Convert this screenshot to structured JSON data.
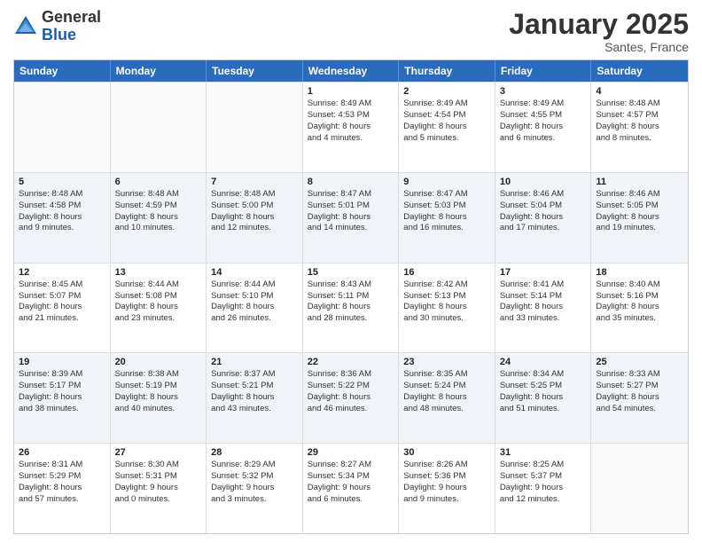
{
  "header": {
    "logo_general": "General",
    "logo_blue": "Blue",
    "month_title": "January 2025",
    "location": "Santes, France"
  },
  "weekdays": [
    "Sunday",
    "Monday",
    "Tuesday",
    "Wednesday",
    "Thursday",
    "Friday",
    "Saturday"
  ],
  "rows": [
    {
      "alt": false,
      "cells": [
        {
          "day": "",
          "lines": []
        },
        {
          "day": "",
          "lines": []
        },
        {
          "day": "",
          "lines": []
        },
        {
          "day": "1",
          "lines": [
            "Sunrise: 8:49 AM",
            "Sunset: 4:53 PM",
            "Daylight: 8 hours",
            "and 4 minutes."
          ]
        },
        {
          "day": "2",
          "lines": [
            "Sunrise: 8:49 AM",
            "Sunset: 4:54 PM",
            "Daylight: 8 hours",
            "and 5 minutes."
          ]
        },
        {
          "day": "3",
          "lines": [
            "Sunrise: 8:49 AM",
            "Sunset: 4:55 PM",
            "Daylight: 8 hours",
            "and 6 minutes."
          ]
        },
        {
          "day": "4",
          "lines": [
            "Sunrise: 8:48 AM",
            "Sunset: 4:57 PM",
            "Daylight: 8 hours",
            "and 8 minutes."
          ]
        }
      ]
    },
    {
      "alt": true,
      "cells": [
        {
          "day": "5",
          "lines": [
            "Sunrise: 8:48 AM",
            "Sunset: 4:58 PM",
            "Daylight: 8 hours",
            "and 9 minutes."
          ]
        },
        {
          "day": "6",
          "lines": [
            "Sunrise: 8:48 AM",
            "Sunset: 4:59 PM",
            "Daylight: 8 hours",
            "and 10 minutes."
          ]
        },
        {
          "day": "7",
          "lines": [
            "Sunrise: 8:48 AM",
            "Sunset: 5:00 PM",
            "Daylight: 8 hours",
            "and 12 minutes."
          ]
        },
        {
          "day": "8",
          "lines": [
            "Sunrise: 8:47 AM",
            "Sunset: 5:01 PM",
            "Daylight: 8 hours",
            "and 14 minutes."
          ]
        },
        {
          "day": "9",
          "lines": [
            "Sunrise: 8:47 AM",
            "Sunset: 5:03 PM",
            "Daylight: 8 hours",
            "and 16 minutes."
          ]
        },
        {
          "day": "10",
          "lines": [
            "Sunrise: 8:46 AM",
            "Sunset: 5:04 PM",
            "Daylight: 8 hours",
            "and 17 minutes."
          ]
        },
        {
          "day": "11",
          "lines": [
            "Sunrise: 8:46 AM",
            "Sunset: 5:05 PM",
            "Daylight: 8 hours",
            "and 19 minutes."
          ]
        }
      ]
    },
    {
      "alt": false,
      "cells": [
        {
          "day": "12",
          "lines": [
            "Sunrise: 8:45 AM",
            "Sunset: 5:07 PM",
            "Daylight: 8 hours",
            "and 21 minutes."
          ]
        },
        {
          "day": "13",
          "lines": [
            "Sunrise: 8:44 AM",
            "Sunset: 5:08 PM",
            "Daylight: 8 hours",
            "and 23 minutes."
          ]
        },
        {
          "day": "14",
          "lines": [
            "Sunrise: 8:44 AM",
            "Sunset: 5:10 PM",
            "Daylight: 8 hours",
            "and 26 minutes."
          ]
        },
        {
          "day": "15",
          "lines": [
            "Sunrise: 8:43 AM",
            "Sunset: 5:11 PM",
            "Daylight: 8 hours",
            "and 28 minutes."
          ]
        },
        {
          "day": "16",
          "lines": [
            "Sunrise: 8:42 AM",
            "Sunset: 5:13 PM",
            "Daylight: 8 hours",
            "and 30 minutes."
          ]
        },
        {
          "day": "17",
          "lines": [
            "Sunrise: 8:41 AM",
            "Sunset: 5:14 PM",
            "Daylight: 8 hours",
            "and 33 minutes."
          ]
        },
        {
          "day": "18",
          "lines": [
            "Sunrise: 8:40 AM",
            "Sunset: 5:16 PM",
            "Daylight: 8 hours",
            "and 35 minutes."
          ]
        }
      ]
    },
    {
      "alt": true,
      "cells": [
        {
          "day": "19",
          "lines": [
            "Sunrise: 8:39 AM",
            "Sunset: 5:17 PM",
            "Daylight: 8 hours",
            "and 38 minutes."
          ]
        },
        {
          "day": "20",
          "lines": [
            "Sunrise: 8:38 AM",
            "Sunset: 5:19 PM",
            "Daylight: 8 hours",
            "and 40 minutes."
          ]
        },
        {
          "day": "21",
          "lines": [
            "Sunrise: 8:37 AM",
            "Sunset: 5:21 PM",
            "Daylight: 8 hours",
            "and 43 minutes."
          ]
        },
        {
          "day": "22",
          "lines": [
            "Sunrise: 8:36 AM",
            "Sunset: 5:22 PM",
            "Daylight: 8 hours",
            "and 46 minutes."
          ]
        },
        {
          "day": "23",
          "lines": [
            "Sunrise: 8:35 AM",
            "Sunset: 5:24 PM",
            "Daylight: 8 hours",
            "and 48 minutes."
          ]
        },
        {
          "day": "24",
          "lines": [
            "Sunrise: 8:34 AM",
            "Sunset: 5:25 PM",
            "Daylight: 8 hours",
            "and 51 minutes."
          ]
        },
        {
          "day": "25",
          "lines": [
            "Sunrise: 8:33 AM",
            "Sunset: 5:27 PM",
            "Daylight: 8 hours",
            "and 54 minutes."
          ]
        }
      ]
    },
    {
      "alt": false,
      "cells": [
        {
          "day": "26",
          "lines": [
            "Sunrise: 8:31 AM",
            "Sunset: 5:29 PM",
            "Daylight: 8 hours",
            "and 57 minutes."
          ]
        },
        {
          "day": "27",
          "lines": [
            "Sunrise: 8:30 AM",
            "Sunset: 5:31 PM",
            "Daylight: 9 hours",
            "and 0 minutes."
          ]
        },
        {
          "day": "28",
          "lines": [
            "Sunrise: 8:29 AM",
            "Sunset: 5:32 PM",
            "Daylight: 9 hours",
            "and 3 minutes."
          ]
        },
        {
          "day": "29",
          "lines": [
            "Sunrise: 8:27 AM",
            "Sunset: 5:34 PM",
            "Daylight: 9 hours",
            "and 6 minutes."
          ]
        },
        {
          "day": "30",
          "lines": [
            "Sunrise: 8:26 AM",
            "Sunset: 5:36 PM",
            "Daylight: 9 hours",
            "and 9 minutes."
          ]
        },
        {
          "day": "31",
          "lines": [
            "Sunrise: 8:25 AM",
            "Sunset: 5:37 PM",
            "Daylight: 9 hours",
            "and 12 minutes."
          ]
        },
        {
          "day": "",
          "lines": []
        }
      ]
    }
  ]
}
